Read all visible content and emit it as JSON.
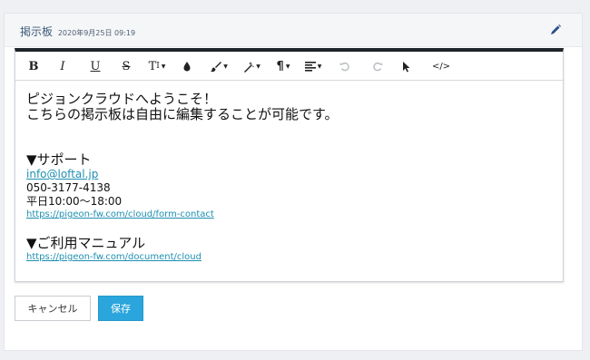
{
  "header": {
    "title": "掲示板",
    "date": "2020年9月25日 09:19",
    "edit_icon": "pencil-icon"
  },
  "toolbar": {
    "items": [
      {
        "name": "bold",
        "label": "B"
      },
      {
        "name": "italic",
        "label": "I"
      },
      {
        "name": "underline",
        "label": "U"
      },
      {
        "name": "strikethrough",
        "label": "S"
      },
      {
        "name": "font-size",
        "label": "T"
      },
      {
        "name": "text-color",
        "label": "droplet-icon"
      },
      {
        "name": "brush",
        "label": "brush-icon"
      },
      {
        "name": "highlighter",
        "label": "magic-wand-icon"
      },
      {
        "name": "paragraph",
        "label": "¶"
      },
      {
        "name": "align",
        "label": "align-icon"
      },
      {
        "name": "undo",
        "label": "undo-icon"
      },
      {
        "name": "redo",
        "label": "redo-icon"
      },
      {
        "name": "select",
        "label": "cursor-icon"
      },
      {
        "name": "code",
        "label": "</>"
      }
    ]
  },
  "content": {
    "line1": "ピジョンクラウドへようこそ！",
    "line2": "こちらの掲示板は自由に編集することが可能です。",
    "support_heading": "▼サポート",
    "email": "info@loftal.jp",
    "phone": "050-3177-4138",
    "hours": "平日10:00～18:00",
    "contact_url": "https://pigeon-fw.com/cloud/form-contact",
    "manual_heading": "▼ご利用マニュアル",
    "manual_url": "https://pigeon-fw.com/document/cloud"
  },
  "buttons": {
    "cancel": "キャンセル",
    "save": "保存"
  },
  "colors": {
    "accent": "#2aa6dc",
    "link": "#1e8fb0",
    "toolbar_top": "#1f2429"
  }
}
